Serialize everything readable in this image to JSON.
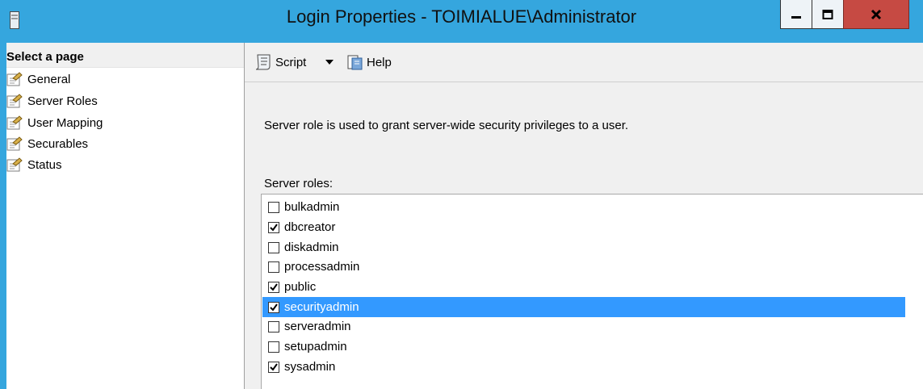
{
  "window": {
    "title": "Login Properties - TOIMIALUE\\Administrator",
    "icons": {
      "app": "app-icon",
      "minimize": "minimize-icon",
      "maximize": "maximize-icon",
      "close": "close-icon"
    }
  },
  "left_pane": {
    "header": "Select a page",
    "pages": [
      {
        "label": "General",
        "icon": "page-wrench-icon"
      },
      {
        "label": "Server Roles",
        "icon": "page-wrench-icon"
      },
      {
        "label": "User Mapping",
        "icon": "page-wrench-icon"
      },
      {
        "label": "Securables",
        "icon": "page-wrench-icon"
      },
      {
        "label": "Status",
        "icon": "page-wrench-icon"
      }
    ]
  },
  "toolbar": {
    "script_label": "Script",
    "help_label": "Help",
    "icons": {
      "script": "script-icon",
      "dropdown": "dropdown-arrow-icon",
      "help": "help-icon"
    }
  },
  "main": {
    "description": "Server role is used to grant server-wide security privileges to a user.",
    "roles_label": "Server roles:",
    "roles": [
      {
        "name": "bulkadmin",
        "checked": false
      },
      {
        "name": "dbcreator",
        "checked": true
      },
      {
        "name": "diskadmin",
        "checked": false
      },
      {
        "name": "processadmin",
        "checked": false
      },
      {
        "name": "public",
        "checked": true
      },
      {
        "name": "securityadmin",
        "checked": true,
        "selected": true
      },
      {
        "name": "serveradmin",
        "checked": false
      },
      {
        "name": "setupadmin",
        "checked": false
      },
      {
        "name": "sysadmin",
        "checked": true
      }
    ]
  },
  "colors": {
    "titlebar": "#35a6de",
    "selection": "#3399ff",
    "close_button": "#c64a43"
  }
}
